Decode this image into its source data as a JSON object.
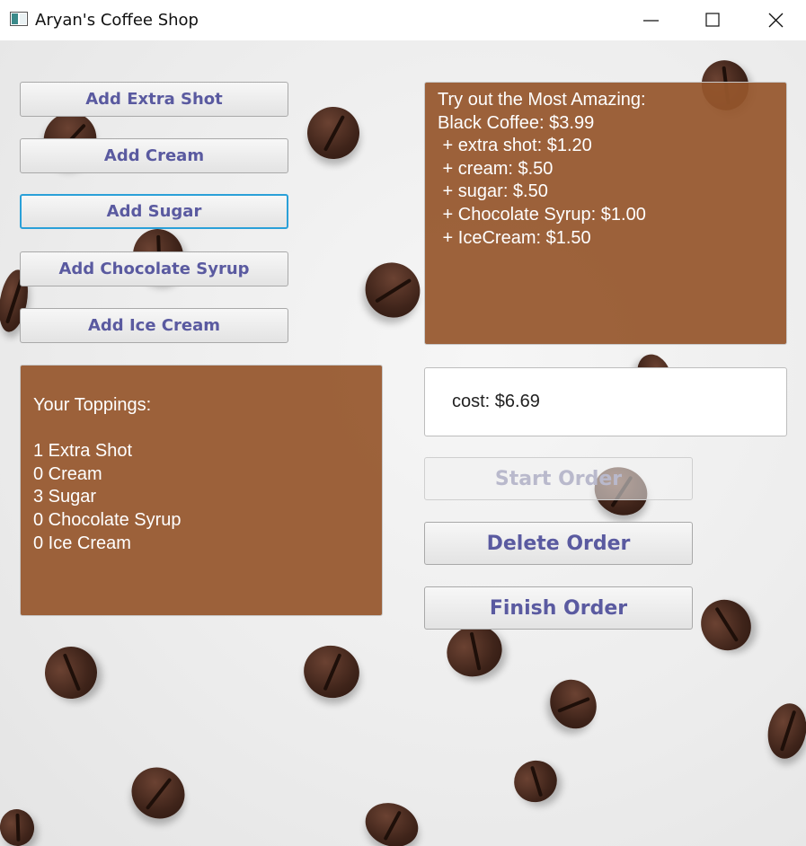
{
  "window": {
    "title": "Aryan's Coffee Shop"
  },
  "toppings_buttons": {
    "extra_shot": "Add Extra Shot",
    "cream": "Add Cream",
    "sugar": "Add Sugar",
    "chocolate_syrup": "Add Chocolate Syrup",
    "ice_cream": "Add Ice Cream"
  },
  "menu": {
    "lines": [
      "Try out the Most Amazing:",
      "Black Coffee: $3.99",
      " + extra shot: $1.20",
      " + cream: $.50",
      " + sugar: $.50",
      " + Chocolate Syrup: $1.00",
      " + IceCream: $1.50"
    ]
  },
  "toppings_summary": {
    "heading": "Your Toppings:",
    "lines": [
      "1 Extra Shot",
      "0 Cream",
      "3 Sugar",
      "0 Chocolate Syrup",
      "0 Ice Cream"
    ]
  },
  "cost": {
    "text": "cost: $6.69"
  },
  "order_buttons": {
    "start": "Start Order",
    "delete": "Delete Order",
    "finish": "Finish Order"
  },
  "colors": {
    "button_text": "#5a5aa0",
    "panel_brown": "#96562c",
    "focus_border": "#2aa0d8"
  }
}
